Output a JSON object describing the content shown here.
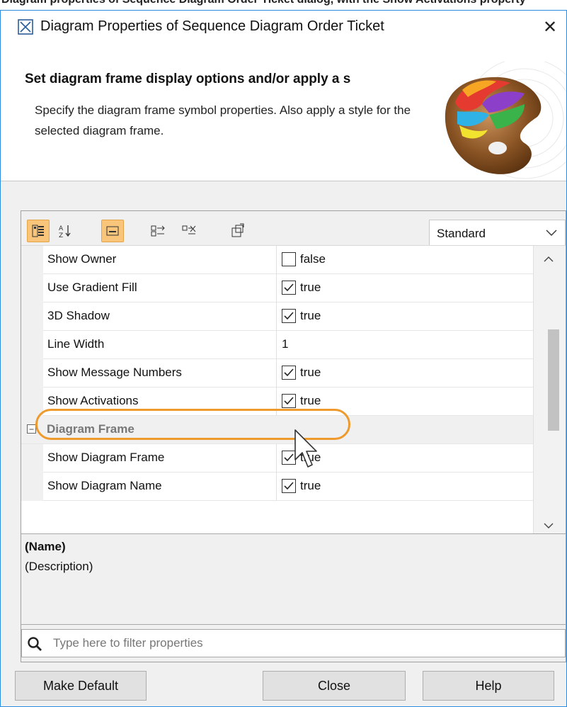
{
  "top_strip_text": "Diagram properties of Sequence Diagram Order Ticket dialog, with the Show Activations property",
  "window": {
    "title": "Diagram Properties of Sequence Diagram Order Ticket",
    "close_glyph": "✕"
  },
  "header": {
    "title": "Set diagram frame display options and/or apply a s",
    "description": "Specify the diagram frame symbol properties. Also apply a style for the selected diagram frame."
  },
  "toolbar": {
    "buttons": [
      {
        "icon": "categorized-view-icon",
        "active": true
      },
      {
        "icon": "sort-alphabetical-icon",
        "active": false
      },
      {
        "icon": "description-toggle-icon",
        "active": true
      },
      {
        "icon": "expand-all-icon",
        "active": false
      },
      {
        "icon": "collapse-all-icon",
        "active": false
      },
      {
        "icon": "open-in-new-window-icon",
        "active": false
      }
    ],
    "mode_select": {
      "value": "Standard"
    }
  },
  "properties": [
    {
      "name": "Show Owner",
      "type": "checkbox",
      "checked": false,
      "value": "false"
    },
    {
      "name": "Use Gradient Fill",
      "type": "checkbox",
      "checked": true,
      "value": "true"
    },
    {
      "name": "3D Shadow",
      "type": "checkbox",
      "checked": true,
      "value": "true"
    },
    {
      "name": "Line Width",
      "type": "text",
      "value": "1"
    },
    {
      "name": "Show Message Numbers",
      "type": "checkbox",
      "checked": true,
      "value": "true"
    },
    {
      "name": "Show Activations",
      "type": "checkbox",
      "checked": true,
      "value": "true",
      "highlighted": true
    },
    {
      "category": "Diagram Frame",
      "toggle": "−"
    },
    {
      "name": "Show Diagram Frame",
      "type": "checkbox",
      "checked": true,
      "value": "true"
    },
    {
      "name": "Show Diagram Name",
      "type": "checkbox",
      "checked": true,
      "value": "true"
    }
  ],
  "description_panel": {
    "name": "(Name)",
    "description": "(Description)"
  },
  "filter": {
    "placeholder": "Type here to filter properties"
  },
  "buttons": {
    "make_default": "Make Default",
    "close": "Close",
    "help": "Help"
  },
  "colors": {
    "accent_highlight": "#ee9a2d",
    "toolbar_active": "#f9c57b",
    "window_border": "#2b8ce0"
  }
}
